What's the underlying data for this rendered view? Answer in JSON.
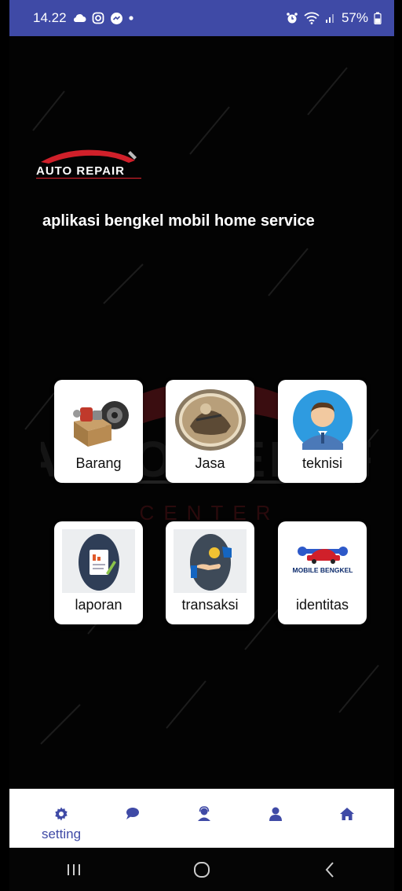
{
  "status_bar": {
    "time": "14.22",
    "battery": "57%"
  },
  "header": {
    "logo_text": "AUTO REPAIR",
    "tagline": "aplikasi bengkel mobil home service"
  },
  "menu": [
    {
      "label": "Barang",
      "icon": "parts-box-icon"
    },
    {
      "label": "Jasa",
      "icon": "mechanic-icon"
    },
    {
      "label": "teknisi",
      "icon": "technician-avatar-icon"
    },
    {
      "label": "laporan",
      "icon": "report-document-icon"
    },
    {
      "label": "transaksi",
      "icon": "payment-hand-icon"
    },
    {
      "label": "identitas",
      "icon": "mobile-bengkel-logo"
    }
  ],
  "identitas_logo_text": "MOBILE BENGKEL",
  "bottom_nav": {
    "active_label": "setting",
    "items": [
      "gear-icon",
      "chat-icon",
      "support-agent-icon",
      "person-icon",
      "home-icon"
    ]
  },
  "colors": {
    "accent": "#3f4aa6",
    "background": "#030303",
    "logo_red": "#d0202a"
  }
}
